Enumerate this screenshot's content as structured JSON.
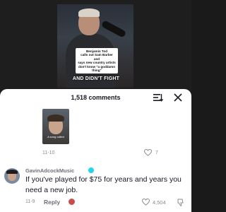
{
  "video": {
    "caption_lines": [
      "Benjamin Tod",
      "calls out Sam Barber and",
      "says new country artists",
      "don't know \"a goddamn",
      "thing\""
    ],
    "caption_bold": "AND DIDN'T FIGHT"
  },
  "comments_sheet": {
    "count_label": "1,518 comments",
    "filter_icon": "filter-sort-icon",
    "close_icon": "close-icon"
  },
  "comment_1": {
    "thumb_caption": "A song\ncalled",
    "date": "11-10",
    "like_count": "7"
  },
  "comment_2": {
    "username": "GavinAdcockMusic",
    "text": "If you've played for $75 for years and years you need a new job.",
    "date": "11-9",
    "reply_label": "Reply",
    "like_count": "4,504",
    "colors": {
      "verified": "#20d5ec"
    }
  }
}
